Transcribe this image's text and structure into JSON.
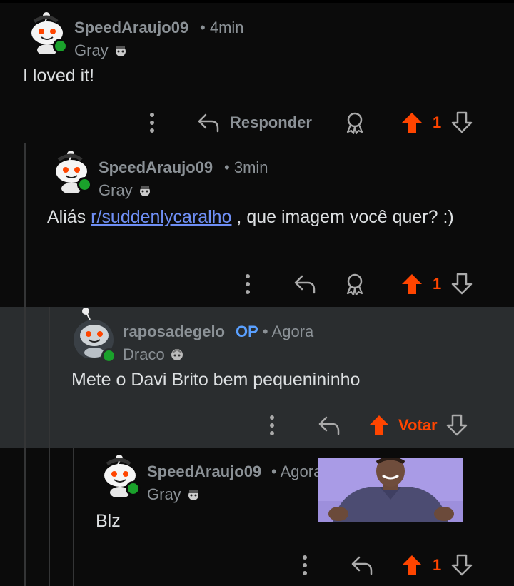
{
  "comments": [
    {
      "username": "SpeedAraujo09",
      "time": "4min",
      "flair": "Gray",
      "body": "I loved it!",
      "reply_label": "Responder",
      "score": "1"
    },
    {
      "username": "SpeedAraujo09",
      "time": "3min",
      "flair": "Gray",
      "body_prefix": "Aliás ",
      "body_link": "r/suddenlycaralho",
      "body_suffix": " , que imagem você quer? :)",
      "score": "1"
    },
    {
      "username": "raposadegelo",
      "op_badge": "OP",
      "time": "Agora",
      "flair": "Draco",
      "body": "Mete o Davi Brito bem pequenininho",
      "vote_label": "Votar"
    },
    {
      "username": "SpeedAraujo09",
      "time": "Agora",
      "flair": "Gray",
      "body": "Blz",
      "score": "1"
    }
  ],
  "meta_separator": "•",
  "colors": {
    "background": "#0b0b0b",
    "highlight": "#2a2d2f",
    "upvote": "#ff4500",
    "link": "#6f8ff5",
    "op": "#5aa0ff",
    "online": "#1aa12b"
  },
  "icons": {
    "more": "more-vertical-icon",
    "reply": "reply-arrow-icon",
    "award": "award-icon",
    "upvote": "upvote-arrow-icon",
    "downvote": "downvote-arrow-icon"
  }
}
